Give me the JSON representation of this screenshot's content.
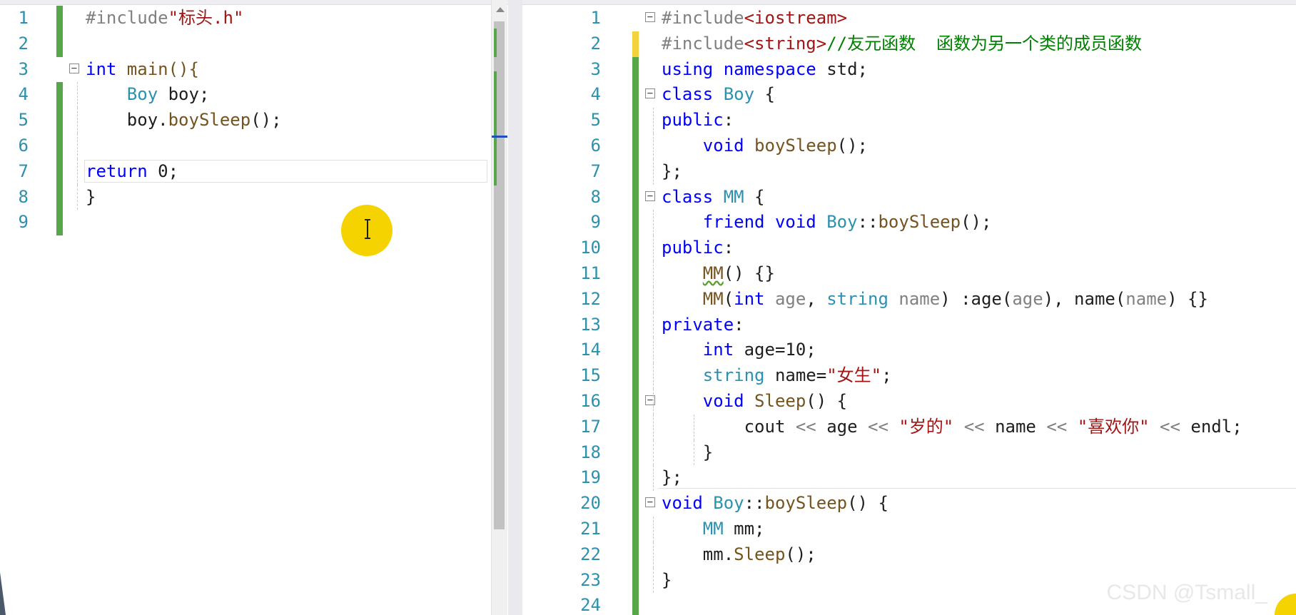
{
  "left_editor": {
    "lines": [
      {
        "num": "1",
        "tokens": [
          {
            "t": "#include",
            "c": "pp"
          },
          {
            "t": "\"标头.h\"",
            "c": "str"
          }
        ]
      },
      {
        "num": "2",
        "tokens": []
      },
      {
        "num": "3",
        "tokens": [
          {
            "t": "int",
            "c": "kw"
          },
          {
            "t": " main(){",
            "c": "fn"
          }
        ]
      },
      {
        "num": "4",
        "tokens": [
          {
            "t": "    ",
            "c": ""
          },
          {
            "t": "Boy",
            "c": "typ"
          },
          {
            "t": " boy;",
            "c": ""
          }
        ]
      },
      {
        "num": "5",
        "tokens": [
          {
            "t": "    boy.",
            "c": ""
          },
          {
            "t": "boySleep",
            "c": "fn"
          },
          {
            "t": "();",
            "c": ""
          }
        ]
      },
      {
        "num": "6",
        "tokens": []
      },
      {
        "num": "7",
        "tokens": [
          {
            "t": "return",
            "c": "kw"
          },
          {
            "t": " 0;",
            "c": ""
          }
        ]
      },
      {
        "num": "8",
        "tokens": [
          {
            "t": "}",
            "c": ""
          }
        ]
      },
      {
        "num": "9",
        "tokens": []
      }
    ]
  },
  "right_editor": {
    "lines": [
      {
        "num": "1",
        "tokens": [
          {
            "t": "#include",
            "c": "pp"
          },
          {
            "t": "<iostream>",
            "c": "str"
          }
        ]
      },
      {
        "num": "2",
        "tokens": [
          {
            "t": "#include",
            "c": "pp"
          },
          {
            "t": "<string>",
            "c": "str"
          },
          {
            "t": "//友元函数  函数为另一个类的成员函数",
            "c": "cmt"
          }
        ]
      },
      {
        "num": "3",
        "tokens": [
          {
            "t": "using namespace",
            "c": "kw"
          },
          {
            "t": " std;",
            "c": ""
          }
        ]
      },
      {
        "num": "4",
        "tokens": [
          {
            "t": "class",
            "c": "kw"
          },
          {
            "t": " ",
            "c": ""
          },
          {
            "t": "Boy",
            "c": "typ"
          },
          {
            "t": " {",
            "c": ""
          }
        ]
      },
      {
        "num": "5",
        "tokens": [
          {
            "t": "public",
            "c": "kw"
          },
          {
            "t": ":",
            "c": ""
          }
        ]
      },
      {
        "num": "6",
        "tokens": [
          {
            "t": "    ",
            "c": ""
          },
          {
            "t": "void",
            "c": "kw"
          },
          {
            "t": " ",
            "c": ""
          },
          {
            "t": "boySleep",
            "c": "fn"
          },
          {
            "t": "();",
            "c": ""
          }
        ]
      },
      {
        "num": "7",
        "tokens": [
          {
            "t": "};",
            "c": ""
          }
        ]
      },
      {
        "num": "8",
        "tokens": [
          {
            "t": "class",
            "c": "kw"
          },
          {
            "t": " ",
            "c": ""
          },
          {
            "t": "MM",
            "c": "typ"
          },
          {
            "t": " {",
            "c": ""
          }
        ]
      },
      {
        "num": "9",
        "tokens": [
          {
            "t": "    ",
            "c": ""
          },
          {
            "t": "friend void",
            "c": "kw"
          },
          {
            "t": " ",
            "c": ""
          },
          {
            "t": "Boy",
            "c": "typ"
          },
          {
            "t": "::",
            "c": ""
          },
          {
            "t": "boySleep",
            "c": "fn"
          },
          {
            "t": "();",
            "c": ""
          }
        ]
      },
      {
        "num": "10",
        "tokens": [
          {
            "t": "public",
            "c": "kw"
          },
          {
            "t": ":",
            "c": ""
          }
        ]
      },
      {
        "num": "11",
        "tokens": [
          {
            "t": "    ",
            "c": ""
          },
          {
            "t": "MM",
            "c": "fn squig"
          },
          {
            "t": "() {}",
            "c": ""
          }
        ]
      },
      {
        "num": "12",
        "tokens": [
          {
            "t": "    ",
            "c": ""
          },
          {
            "t": "MM",
            "c": "fn"
          },
          {
            "t": "(",
            "c": ""
          },
          {
            "t": "int",
            "c": "kw"
          },
          {
            "t": " ",
            "c": ""
          },
          {
            "t": "age",
            "c": "par"
          },
          {
            "t": ", ",
            "c": ""
          },
          {
            "t": "string",
            "c": "typ"
          },
          {
            "t": " ",
            "c": ""
          },
          {
            "t": "name",
            "c": "par"
          },
          {
            "t": ") :age(",
            "c": ""
          },
          {
            "t": "age",
            "c": "par"
          },
          {
            "t": "), name(",
            "c": ""
          },
          {
            "t": "name",
            "c": "par"
          },
          {
            "t": ") {}",
            "c": ""
          }
        ]
      },
      {
        "num": "13",
        "tokens": [
          {
            "t": "private",
            "c": "kw"
          },
          {
            "t": ":",
            "c": ""
          }
        ]
      },
      {
        "num": "14",
        "tokens": [
          {
            "t": "    ",
            "c": ""
          },
          {
            "t": "int",
            "c": "kw"
          },
          {
            "t": " age=10;",
            "c": ""
          }
        ]
      },
      {
        "num": "15",
        "tokens": [
          {
            "t": "    ",
            "c": ""
          },
          {
            "t": "string",
            "c": "typ"
          },
          {
            "t": " name=",
            "c": ""
          },
          {
            "t": "\"女生\"",
            "c": "str"
          },
          {
            "t": ";",
            "c": ""
          }
        ]
      },
      {
        "num": "16",
        "tokens": [
          {
            "t": "    ",
            "c": ""
          },
          {
            "t": "void",
            "c": "kw"
          },
          {
            "t": " ",
            "c": ""
          },
          {
            "t": "Sleep",
            "c": "fn"
          },
          {
            "t": "() {",
            "c": ""
          }
        ]
      },
      {
        "num": "17",
        "tokens": [
          {
            "t": "        cout ",
            "c": ""
          },
          {
            "t": "<<",
            "c": "par"
          },
          {
            "t": " age ",
            "c": ""
          },
          {
            "t": "<<",
            "c": "par"
          },
          {
            "t": " ",
            "c": ""
          },
          {
            "t": "\"岁的\"",
            "c": "str"
          },
          {
            "t": " ",
            "c": ""
          },
          {
            "t": "<<",
            "c": "par"
          },
          {
            "t": " name ",
            "c": ""
          },
          {
            "t": "<<",
            "c": "par"
          },
          {
            "t": " ",
            "c": ""
          },
          {
            "t": "\"喜欢你\"",
            "c": "str"
          },
          {
            "t": " ",
            "c": ""
          },
          {
            "t": "<<",
            "c": "par"
          },
          {
            "t": " endl;",
            "c": ""
          }
        ]
      },
      {
        "num": "18",
        "tokens": [
          {
            "t": "    }",
            "c": ""
          }
        ]
      },
      {
        "num": "19",
        "tokens": [
          {
            "t": "};",
            "c": ""
          }
        ]
      },
      {
        "num": "20",
        "tokens": [
          {
            "t": "void",
            "c": "kw"
          },
          {
            "t": " ",
            "c": ""
          },
          {
            "t": "Boy",
            "c": "typ"
          },
          {
            "t": "::",
            "c": ""
          },
          {
            "t": "boySleep",
            "c": "fn"
          },
          {
            "t": "() {",
            "c": ""
          }
        ]
      },
      {
        "num": "21",
        "tokens": [
          {
            "t": "    ",
            "c": ""
          },
          {
            "t": "MM",
            "c": "typ"
          },
          {
            "t": " mm;",
            "c": ""
          }
        ]
      },
      {
        "num": "22",
        "tokens": [
          {
            "t": "    mm.",
            "c": ""
          },
          {
            "t": "Sleep",
            "c": "fn"
          },
          {
            "t": "();",
            "c": ""
          }
        ]
      },
      {
        "num": "23",
        "tokens": [
          {
            "t": "}",
            "c": ""
          }
        ]
      },
      {
        "num": "24",
        "tokens": []
      }
    ]
  },
  "watermark": "CSDN @Tsmall_",
  "colors": {
    "change_bar": "#57a64a",
    "change_bar_unsaved": "#f2d33d",
    "cursor_highlight": "#f5d300",
    "line_number": "#2b91af"
  }
}
